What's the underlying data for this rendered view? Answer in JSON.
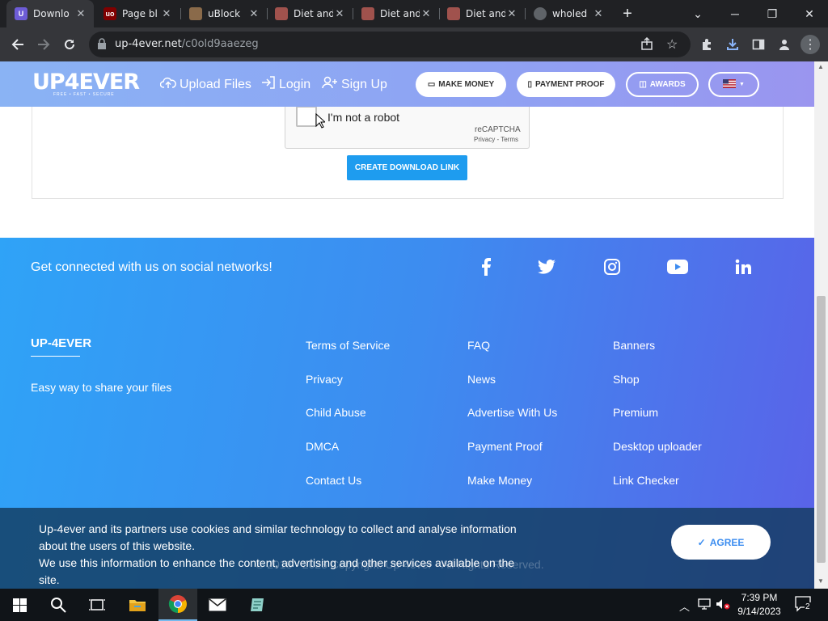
{
  "browser": {
    "tabs": [
      {
        "title": "Downlo",
        "active": true
      },
      {
        "title": "Page bl",
        "active": false
      },
      {
        "title": "uBlock",
        "active": false
      },
      {
        "title": "Diet and",
        "active": false
      },
      {
        "title": "Diet and",
        "active": false
      },
      {
        "title": "Diet and",
        "active": false
      },
      {
        "title": "wholed",
        "active": false
      }
    ],
    "url_domain": "up-4ever.net",
    "url_path": "/c0old9aaezeg"
  },
  "header": {
    "logo": "UP4EVER",
    "logo_tagline": "FREE • FAST • SECURE",
    "nav": {
      "upload": "Upload Files",
      "login": "Login",
      "signup": "Sign Up"
    },
    "buttons": {
      "make_money": "MAKE MONEY",
      "payment_proof": "PAYMENT PROOF",
      "awards": "AWARDS"
    }
  },
  "captcha": {
    "label": "I'm not a robot",
    "brand": "reCAPTCHA",
    "privacy": "Privacy",
    "sep": " - ",
    "terms": "Terms"
  },
  "create_button": "CREATE DOWNLOAD LINK",
  "footer": {
    "social_title": "Get connected with us on social networks!",
    "brand_title": "UP-4EVER",
    "brand_tagline": "Easy way to share your files",
    "col1": [
      "Terms of Service",
      "Privacy",
      "Child Abuse",
      "DMCA",
      "Contact Us"
    ],
    "col2": [
      "FAQ",
      "News",
      "Advertise With Us",
      "Payment Proof",
      "Make Money"
    ],
    "col3": [
      "Banners",
      "Shop",
      "Premium",
      "Desktop uploader",
      "Link Checker"
    ],
    "copyright": "© 2018 - 2023 Copyright: Up-4ever - All Rights Reserved."
  },
  "cookie": {
    "line1": "Up-4ever and its partners use cookies and similar technology to collect and analyse information about the users of this website.",
    "line2": "We use this information to enhance the content, advertising and other services available on the site.",
    "agree": "AGREE"
  },
  "taskbar": {
    "time": "7:39 PM",
    "date": "9/14/2023",
    "notif_count": "2"
  },
  "colors": {
    "header_gradient_start": "#8ab3f4",
    "footer_gradient_start": "#2fa3f7",
    "footer_gradient_end": "#5a62e8",
    "create_button": "#1e9cef"
  }
}
